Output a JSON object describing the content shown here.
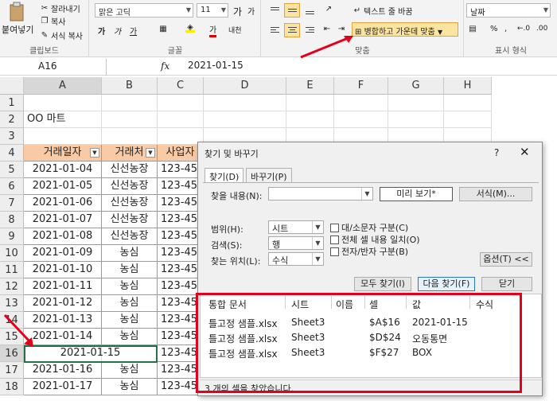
{
  "ribbon": {
    "clipboard": {
      "paste_label": "붙여넣기",
      "cut_label": "잘라내기",
      "copy_label": "복사",
      "format_painter_label": "서식 복사",
      "group_label": "클립보드"
    },
    "font": {
      "font_name": "맑은 고딕",
      "font_size": "11",
      "group_label": "글꼴",
      "bold_label": "가",
      "italic_label": "가",
      "underline_label": "가",
      "phonetic_label": "내천",
      "font_color_label": "가"
    },
    "alignment": {
      "wrap_text_label": "텍스트 줄 바꿈",
      "merge_center_label": "병합하고 가운데 맞춤",
      "group_label": "맞춤"
    },
    "number": {
      "format": "날짜",
      "percent": "%",
      "comma": ",",
      "group_label": "표시 형식"
    }
  },
  "formula_bar": {
    "name_box": "A16",
    "fx": "fx",
    "value": "2021-01-15"
  },
  "sheet": {
    "columns": [
      "A",
      "B",
      "C",
      "D",
      "E",
      "F",
      "G",
      "H"
    ],
    "rows": [
      "1",
      "2",
      "3",
      "4",
      "5",
      "6",
      "7",
      "8",
      "9",
      "10",
      "11",
      "12",
      "13",
      "14",
      "15",
      "16",
      "17",
      "18"
    ],
    "title_cell": "OO 마트",
    "headers": [
      "거래일자",
      "거래처",
      "사업자"
    ],
    "data": [
      [
        "2021-01-04",
        "신선농장",
        "123-45"
      ],
      [
        "2021-01-05",
        "신선농장",
        "123-45"
      ],
      [
        "2021-01-06",
        "신선농장",
        "123-45"
      ],
      [
        "2021-01-07",
        "신선농장",
        "123-45"
      ],
      [
        "2021-01-08",
        "신선농장",
        "123-45"
      ],
      [
        "2021-01-09",
        "농심",
        "123-45"
      ],
      [
        "2021-01-10",
        "농심",
        "123-45"
      ],
      [
        "2021-01-11",
        "농심",
        "123-45"
      ],
      [
        "2021-01-12",
        "농심",
        "123-45"
      ],
      [
        "2021-01-13",
        "농심",
        "123-45"
      ],
      [
        "2021-01-14",
        "농심",
        "123-45"
      ],
      [
        "2021-01-15",
        "",
        "123-45"
      ],
      [
        "2021-01-16",
        "농심",
        "123-45"
      ],
      [
        "2021-01-17",
        "농심",
        "123-45"
      ]
    ]
  },
  "dialog": {
    "title": "찾기 및 바꾸기",
    "help": "?",
    "close": "✕",
    "tabs": [
      "찾기(D)",
      "바꾸기(P)"
    ],
    "find_what_label": "찾을 내용(N):",
    "find_what_value": "",
    "preview_label": "미리 보기*",
    "format_button": "서식(M)...",
    "within_label": "범위(H):",
    "within_value": "시트",
    "search_label": "검색(S):",
    "search_value": "행",
    "look_in_label": "찾는 위치(L):",
    "look_in_value": "수식",
    "match_case": "대/소문자 구분(C)",
    "match_entire": "전체 셀 내용 일치(O)",
    "match_byte": "전자/반자 구분(B)",
    "options_button": "옵션(T) <<",
    "find_all_button": "모두 찾기(I)",
    "find_next_button": "다음 찾기(F)",
    "close_button": "닫기",
    "results_headers": [
      "통합 문서",
      "시트",
      "이름",
      "셀",
      "값",
      "수식"
    ],
    "results": [
      {
        "book": "틀고정 샘플.xlsx",
        "sheet": "Sheet3",
        "name": "",
        "cell": "$A$16",
        "value": "2021-01-15",
        "formula": ""
      },
      {
        "book": "틀고정 샘플.xlsx",
        "sheet": "Sheet3",
        "name": "",
        "cell": "$D$24",
        "value": "오동통면",
        "formula": ""
      },
      {
        "book": "틀고정 샘플.xlsx",
        "sheet": "Sheet3",
        "name": "",
        "cell": "$F$27",
        "value": "BOX",
        "formula": ""
      }
    ],
    "status": "3 개의 셀을 찾았습니다."
  },
  "colors": {
    "header_fill": "#f8cba6",
    "highlight_red": "#e4001b",
    "active_cell": "#217346"
  }
}
